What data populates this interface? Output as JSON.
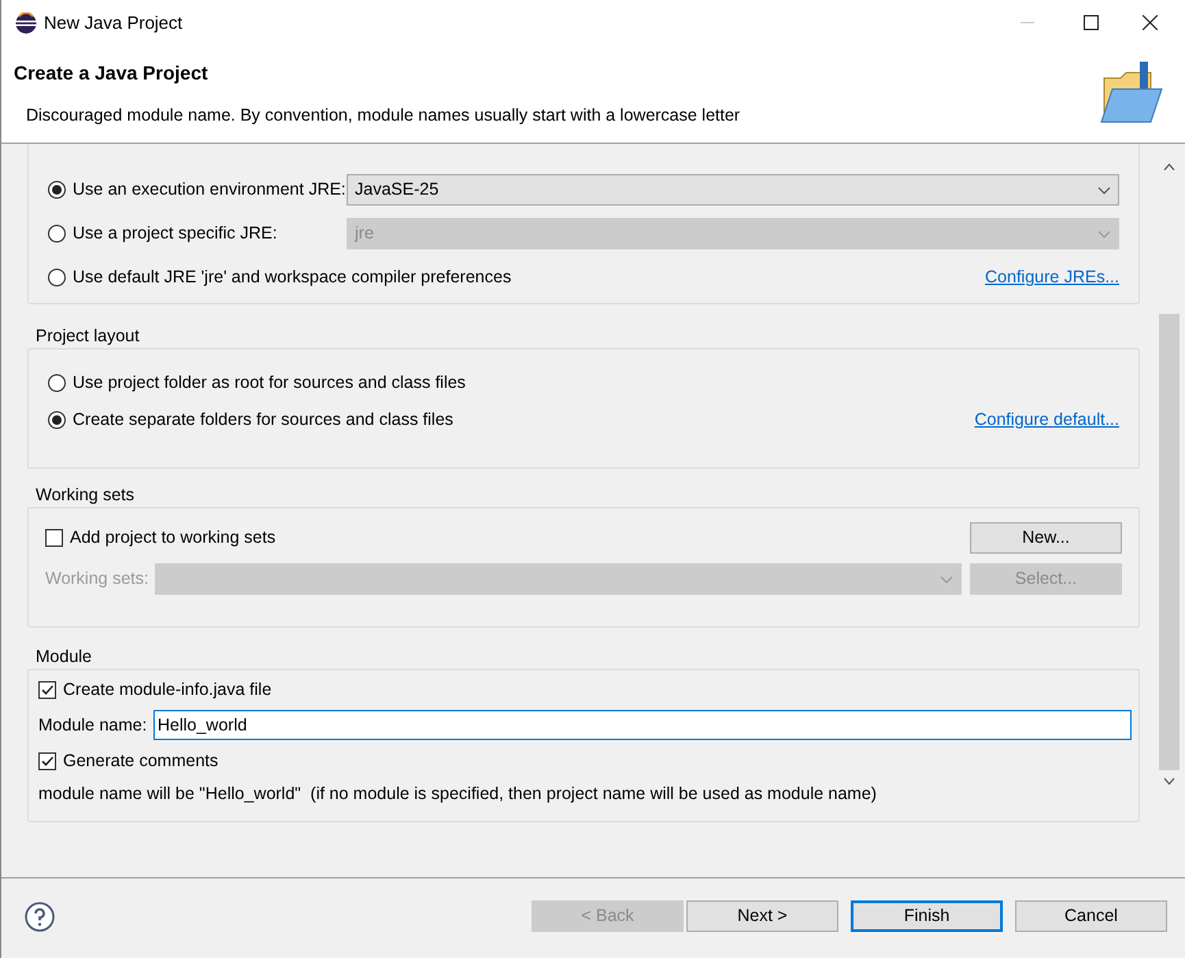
{
  "window": {
    "title": "New Java Project"
  },
  "header": {
    "title": "Create a Java Project",
    "message": "Discouraged module name. By convention, module names usually start with a lowercase letter"
  },
  "jre": {
    "options": [
      {
        "label": "Use an execution environment JRE:",
        "selected": true,
        "kind": "combo",
        "combo": {
          "value": "JavaSE-25",
          "disabled": false
        }
      },
      {
        "label": "Use a project specific JRE:",
        "selected": false,
        "kind": "combo",
        "combo": {
          "value": "jre",
          "disabled": true
        }
      },
      {
        "label": "Use default JRE 'jre' and workspace compiler preferences",
        "selected": false,
        "kind": "link",
        "link": "Configure JREs..."
      }
    ]
  },
  "project_layout": {
    "title": "Project layout",
    "options": [
      {
        "label": "Use project folder as root for sources and class files",
        "selected": false
      },
      {
        "label": "Create separate folders for sources and class files",
        "selected": true
      }
    ],
    "link": "Configure default..."
  },
  "working_sets": {
    "title": "Working sets",
    "checkbox": {
      "label": "Add project to working sets",
      "checked": false
    },
    "new_button": {
      "label": "New...",
      "disabled": false
    },
    "field_label": "Working sets:",
    "field_disabled": true,
    "select_button": {
      "label": "Select...",
      "disabled": true
    }
  },
  "module": {
    "title": "Module",
    "create_info": {
      "label": "Create module-info.java file",
      "checked": true
    },
    "name_label": "Module name:",
    "name_value": "Hello_world",
    "generate_comments": {
      "label": "Generate comments",
      "checked": true
    },
    "note": "module name will be \"Hello_world\"  (if no module is specified, then project name will be used as module name)"
  },
  "buttons": [
    {
      "label": "< Back",
      "disabled": true,
      "default": false
    },
    {
      "label": "Next >",
      "disabled": false,
      "default": false
    },
    {
      "label": "Finish",
      "disabled": false,
      "default": true
    },
    {
      "label": "Cancel",
      "disabled": false,
      "default": false
    }
  ]
}
